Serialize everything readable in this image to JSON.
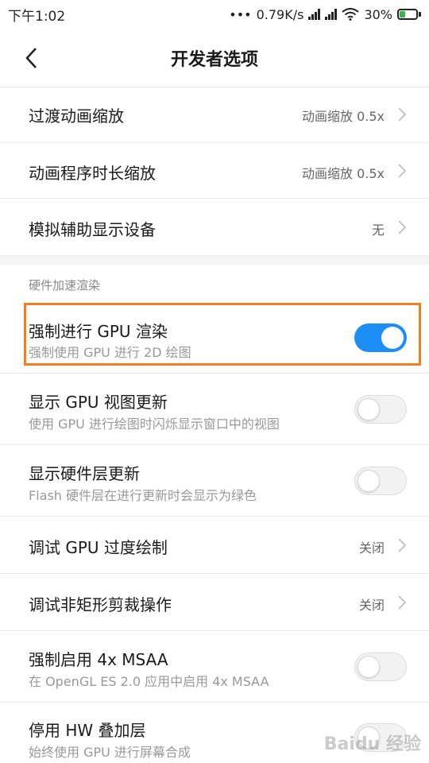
{
  "status_bar": {
    "time": "下午1:02",
    "dots": "•••",
    "network_speed": "0.79K/s",
    "battery": "30%"
  },
  "header": {
    "title": "开发者选项"
  },
  "rows": [
    {
      "label": "过渡动画缩放",
      "value": "动画缩放 0.5x"
    },
    {
      "label": "动画程序时长缩放",
      "value": "动画缩放 0.5x"
    },
    {
      "label": "模拟辅助显示设备",
      "value": "无"
    }
  ],
  "section": {
    "title": "硬件加速渲染"
  },
  "items": [
    {
      "label": "强制进行 GPU 渲染",
      "sub": "强制使用 GPU 进行 2D 绘图",
      "toggle": true
    },
    {
      "label": "显示 GPU 视图更新",
      "sub": "使用 GPU 进行绘图时闪烁显示窗口中的视图",
      "toggle": false
    },
    {
      "label": "显示硬件层更新",
      "sub": "Flash 硬件层在进行更新时会显示为绿色",
      "toggle": false
    },
    {
      "label": "调试 GPU 过度绘制",
      "value": "关闭"
    },
    {
      "label": "调试非矩形剪裁操作",
      "value": "关闭"
    },
    {
      "label": "强制启用 4x MSAA",
      "sub": "在 OpenGL ES 2.0 应用中启用 4x MSAA",
      "toggle": false
    },
    {
      "label": "停用 HW 叠加层",
      "sub": "始终使用 GPU 进行屏幕合成",
      "toggle": false
    }
  ],
  "watermark": "Baidu 经验",
  "colors": {
    "accent": "#1d8ef6",
    "highlight": "#f47e20"
  }
}
